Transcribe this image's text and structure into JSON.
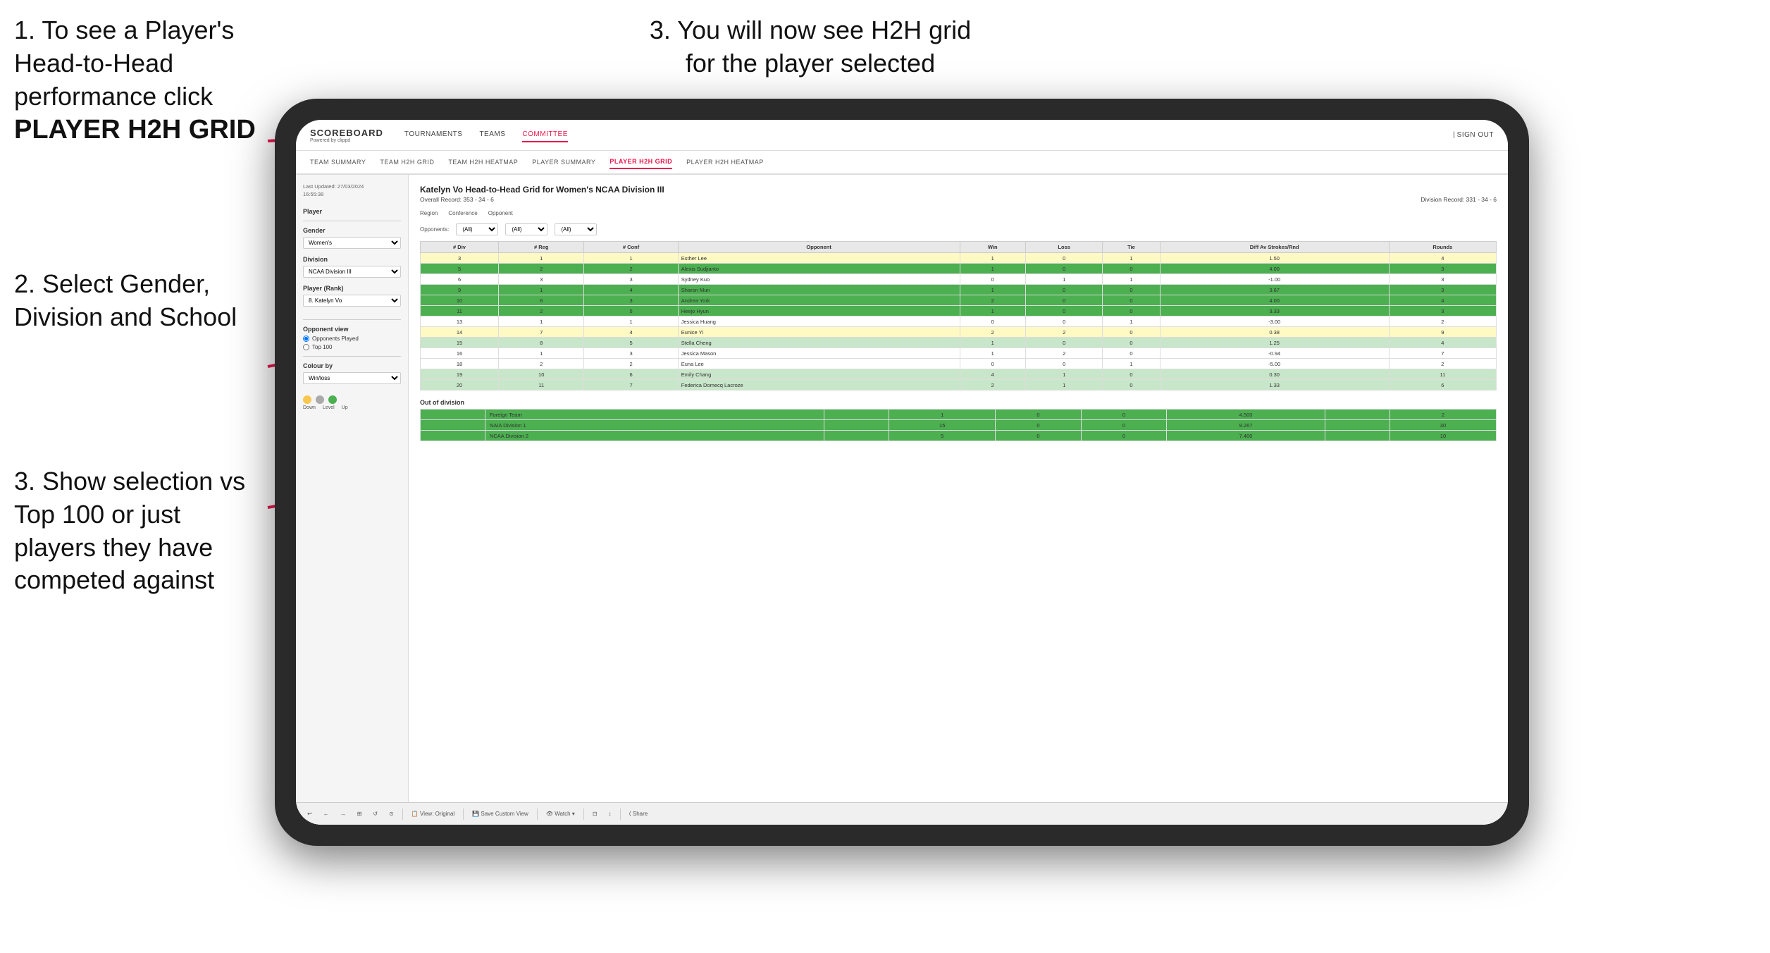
{
  "instructions": {
    "top_left_1": "1. To see a Player's Head-to-Head performance click",
    "top_left_2": "PLAYER H2H GRID",
    "top_right": "3. You will now see H2H grid for the player selected",
    "mid_left_title": "2. Select Gender, Division and School",
    "bottom_left_title": "3. Show selection vs Top 100 or just players they have competed against"
  },
  "nav": {
    "logo": "SCOREBOARD",
    "logo_sub": "Powered by clippd",
    "links": [
      "TOURNAMENTS",
      "TEAMS",
      "COMMITTEE"
    ],
    "active_link": "COMMITTEE",
    "right": "Sign out"
  },
  "sub_nav": {
    "links": [
      "TEAM SUMMARY",
      "TEAM H2H GRID",
      "TEAM H2H HEATMAP",
      "PLAYER SUMMARY",
      "PLAYER H2H GRID",
      "PLAYER H2H HEATMAP"
    ],
    "active": "PLAYER H2H GRID"
  },
  "sidebar": {
    "timestamp": "Last Updated: 27/03/2024\n16:55:38",
    "player_label": "Player",
    "gender_label": "Gender",
    "gender_value": "Women's",
    "division_label": "Division",
    "division_value": "NCAA Division III",
    "player_rank_label": "Player (Rank)",
    "player_rank_value": "8. Katelyn Vo",
    "opponent_view_label": "Opponent view",
    "radio1": "Opponents Played",
    "radio2": "Top 100",
    "colour_by_label": "Colour by",
    "colour_by_value": "Win/loss",
    "colour_labels": [
      "Down",
      "Level",
      "Up"
    ]
  },
  "content": {
    "title": "Katelyn Vo Head-to-Head Grid for Women's NCAA Division III",
    "overall_record": "Overall Record: 353 - 34 - 6",
    "division_record": "Division Record: 331 - 34 - 6",
    "region_label": "Region",
    "conference_label": "Conference",
    "opponent_label": "Opponent",
    "opponents_label": "Opponents:",
    "filter_all": "(All)",
    "columns": [
      "# Div",
      "# Reg",
      "# Conf",
      "Opponent",
      "Win",
      "Loss",
      "Tie",
      "Diff Av Strokes/Rnd",
      "Rounds"
    ],
    "rows": [
      {
        "div": "3",
        "reg": "1",
        "conf": "1",
        "opponent": "Esther Lee",
        "win": "1",
        "loss": "0",
        "tie": "1",
        "diff": "1.50",
        "rounds": "4",
        "color": "yellow"
      },
      {
        "div": "5",
        "reg": "2",
        "conf": "2",
        "opponent": "Alexis Sudjianto",
        "win": "1",
        "loss": "0",
        "tie": "0",
        "diff": "4.00",
        "rounds": "3",
        "color": "green-dark"
      },
      {
        "div": "6",
        "reg": "3",
        "conf": "3",
        "opponent": "Sydney Kuo",
        "win": "0",
        "loss": "1",
        "tie": "1",
        "diff": "-1.00",
        "rounds": "3",
        "color": "white"
      },
      {
        "div": "9",
        "reg": "1",
        "conf": "4",
        "opponent": "Sharon Mun",
        "win": "1",
        "loss": "0",
        "tie": "0",
        "diff": "3.67",
        "rounds": "3",
        "color": "green-dark"
      },
      {
        "div": "10",
        "reg": "6",
        "conf": "3",
        "opponent": "Andrea York",
        "win": "2",
        "loss": "0",
        "tie": "0",
        "diff": "4.00",
        "rounds": "4",
        "color": "green-dark"
      },
      {
        "div": "11",
        "reg": "2",
        "conf": "5",
        "opponent": "Heejo Hyun",
        "win": "1",
        "loss": "0",
        "tie": "0",
        "diff": "3.33",
        "rounds": "3",
        "color": "green-dark"
      },
      {
        "div": "13",
        "reg": "1",
        "conf": "1",
        "opponent": "Jessica Huang",
        "win": "0",
        "loss": "0",
        "tie": "1",
        "diff": "-3.00",
        "rounds": "2",
        "color": "white"
      },
      {
        "div": "14",
        "reg": "7",
        "conf": "4",
        "opponent": "Eunice Yi",
        "win": "2",
        "loss": "2",
        "tie": "0",
        "diff": "0.38",
        "rounds": "9",
        "color": "yellow"
      },
      {
        "div": "15",
        "reg": "8",
        "conf": "5",
        "opponent": "Stella Cheng",
        "win": "1",
        "loss": "0",
        "tie": "0",
        "diff": "1.25",
        "rounds": "4",
        "color": "green-light"
      },
      {
        "div": "16",
        "reg": "1",
        "conf": "3",
        "opponent": "Jessica Mason",
        "win": "1",
        "loss": "2",
        "tie": "0",
        "diff": "-0.94",
        "rounds": "7",
        "color": "white"
      },
      {
        "div": "18",
        "reg": "2",
        "conf": "2",
        "opponent": "Euna Lee",
        "win": "0",
        "loss": "0",
        "tie": "1",
        "diff": "-5.00",
        "rounds": "2",
        "color": "white"
      },
      {
        "div": "19",
        "reg": "10",
        "conf": "6",
        "opponent": "Emily Chang",
        "win": "4",
        "loss": "1",
        "tie": "0",
        "diff": "0.30",
        "rounds": "11",
        "color": "green-light"
      },
      {
        "div": "20",
        "reg": "11",
        "conf": "7",
        "opponent": "Federica Domecq Lacroze",
        "win": "2",
        "loss": "1",
        "tie": "0",
        "diff": "1.33",
        "rounds": "6",
        "color": "green-light"
      }
    ],
    "out_of_division_label": "Out of division",
    "out_rows": [
      {
        "label": "Foreign Team",
        "win": "1",
        "loss": "0",
        "tie": "0",
        "diff": "4.500",
        "rounds": "2",
        "color": "green-dark"
      },
      {
        "label": "NAIA Division 1",
        "win": "15",
        "loss": "0",
        "tie": "0",
        "diff": "9.267",
        "rounds": "30",
        "color": "green-dark"
      },
      {
        "label": "NCAA Division 2",
        "win": "5",
        "loss": "0",
        "tie": "0",
        "diff": "7.400",
        "rounds": "10",
        "color": "green-dark"
      }
    ]
  },
  "toolbar": {
    "buttons": [
      "↩",
      "←",
      "→",
      "⊞",
      "↩↺",
      "⊙",
      "View: Original",
      "Save Custom View",
      "👁 Watch ▾",
      "⊡",
      "↕",
      "Share"
    ]
  },
  "colors": {
    "accent": "#e8174d",
    "green_dark": "#4caf50",
    "green_light": "#a5d6a7",
    "yellow": "#fff59d",
    "dot_down": "#f9c74f",
    "dot_level": "#aaaaaa",
    "dot_up": "#4caf50"
  }
}
